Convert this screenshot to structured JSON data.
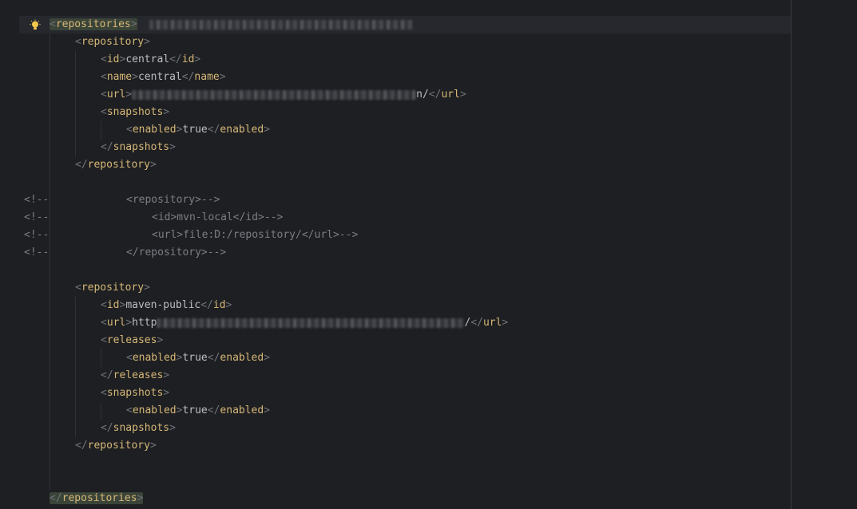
{
  "editor": {
    "lines": [
      {
        "kind": "open",
        "tag": "repositories"
      },
      {
        "kind": "open",
        "tag": "repository"
      },
      {
        "kind": "element",
        "tag": "id",
        "text": "central"
      },
      {
        "kind": "element",
        "tag": "name",
        "text": "central"
      },
      {
        "kind": "element",
        "tag": "url",
        "prefix": "",
        "suffix": "n/"
      },
      {
        "kind": "open",
        "tag": "snapshots"
      },
      {
        "kind": "element",
        "tag": "enabled",
        "text": "true"
      },
      {
        "kind": "close",
        "tag": "snapshots"
      },
      {
        "kind": "close",
        "tag": "repository"
      },
      {
        "kind": "blank"
      },
      {
        "kind": "comment",
        "marker": "<!--",
        "text": "<repository>-->"
      },
      {
        "kind": "comment",
        "marker": "<!--",
        "text": "<id>mvn-local</id>-->"
      },
      {
        "kind": "comment",
        "marker": "<!--",
        "text": "<url>file:D:/repository/</url>-->"
      },
      {
        "kind": "comment",
        "marker": "<!--",
        "text": "</repository>-->"
      },
      {
        "kind": "blank"
      },
      {
        "kind": "open",
        "tag": "repository"
      },
      {
        "kind": "element",
        "tag": "id",
        "text": "maven-public"
      },
      {
        "kind": "element",
        "tag": "url",
        "prefix": "http",
        "suffix": "/"
      },
      {
        "kind": "open",
        "tag": "releases"
      },
      {
        "kind": "element",
        "tag": "enabled",
        "text": "true"
      },
      {
        "kind": "close",
        "tag": "releases"
      },
      {
        "kind": "open",
        "tag": "snapshots"
      },
      {
        "kind": "element",
        "tag": "enabled",
        "text": "true"
      },
      {
        "kind": "close",
        "tag": "snapshots"
      },
      {
        "kind": "close",
        "tag": "repository"
      },
      {
        "kind": "blank"
      },
      {
        "kind": "blank"
      },
      {
        "kind": "close",
        "tag": "repositories"
      }
    ]
  },
  "colors": {
    "background": "#1e1f22",
    "tag": "#d5b778",
    "bracket": "#6f737a",
    "text": "#bcbec4",
    "comment": "#7a7e85",
    "bulb": "#f2c94c"
  }
}
